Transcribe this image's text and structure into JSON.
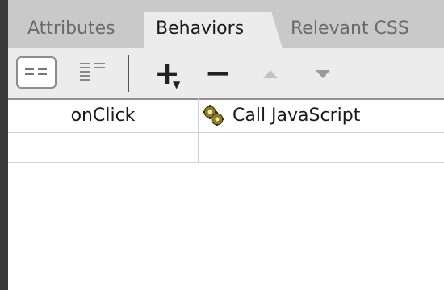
{
  "tabs": [
    {
      "label": "Attributes",
      "active": false
    },
    {
      "label": "Behaviors",
      "active": true
    },
    {
      "label": "Relevant CSS",
      "active": false
    }
  ],
  "toolbar": {
    "show_set_events_icon": "list-set-icon",
    "show_all_events_icon": "list-all-icon",
    "add_label": "+",
    "remove_label": "−",
    "move_up_icon": "triangle-up-icon",
    "move_down_icon": "triangle-down-icon"
  },
  "behaviors": [
    {
      "event": "onClick",
      "action": "Call JavaScript",
      "icon": "gear-icon"
    },
    {
      "event": "",
      "action": ""
    }
  ],
  "colors": {
    "tab_bg": "#c9c9c9",
    "active_tab_bg": "#ececec",
    "toolbar_bg": "#ececec",
    "sidebar": "#3a3a3a"
  }
}
